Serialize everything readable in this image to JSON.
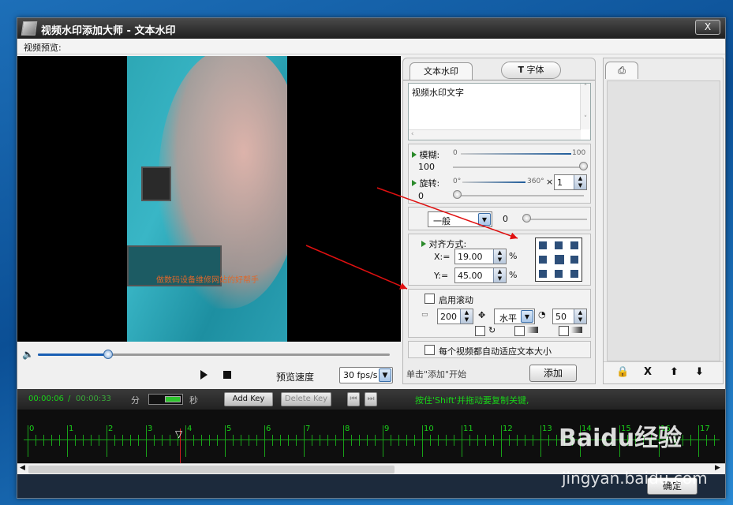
{
  "window": {
    "title": "视频水印添加大师 - 文本水印",
    "close": "X"
  },
  "menu": {
    "preview_label": "视频预览:"
  },
  "video": {
    "watermark_overlay_text": "做数码设备维修网站的好帮手"
  },
  "controls": {
    "speed_label": "预览速度",
    "fps_value": "30 fps/s",
    "seek_progress": 0.2
  },
  "text_panel": {
    "tab_text": "文本水印",
    "tab_font": "字体",
    "text_value": "视频水印文字",
    "blur": {
      "label": "模糊:",
      "min": "0",
      "max": "100",
      "value": "100"
    },
    "rotate": {
      "label": "旋转:",
      "min": "0°",
      "max": "360°",
      "x": "×",
      "multiplier": "1",
      "value": "0"
    },
    "style": {
      "selected": "一般",
      "value": "0"
    },
    "alignment": {
      "label": "对齐方式:",
      "x_label": "X:=",
      "x_value": "19.00",
      "y_label": "Y:=",
      "y_value": "45.00",
      "unit": "%"
    },
    "scroll": {
      "label": "启用滚动",
      "speed": "200",
      "direction": "水平",
      "interval": "50"
    },
    "autosize_label": "每个视频都自动适应文本大小",
    "hint": "单击\"添加\"开始",
    "add_button": "添加"
  },
  "list_panel": {
    "tools": {
      "lock": "🔒",
      "delete": "X",
      "up": "⬆",
      "down": "⬇"
    }
  },
  "timeline": {
    "current_time": "00:00:06",
    "separator": "/",
    "total_time": "00:00:33",
    "min_label": "分",
    "sec_label": "秒",
    "add_key": "Add Key",
    "delete_key": "Delete Key",
    "hint": "按住'Shift'并拖动要复制关键,",
    "ticks": [
      "0",
      "1",
      "2",
      "3",
      "4",
      "5",
      "6",
      "7",
      "8",
      "9",
      "10",
      "11",
      "12",
      "13",
      "14",
      "15",
      "16",
      "17"
    ]
  },
  "footer": {
    "ok_button": "确定"
  },
  "watermark": {
    "brand": "Baidu经验",
    "url": "jingyan.baidu.com"
  }
}
